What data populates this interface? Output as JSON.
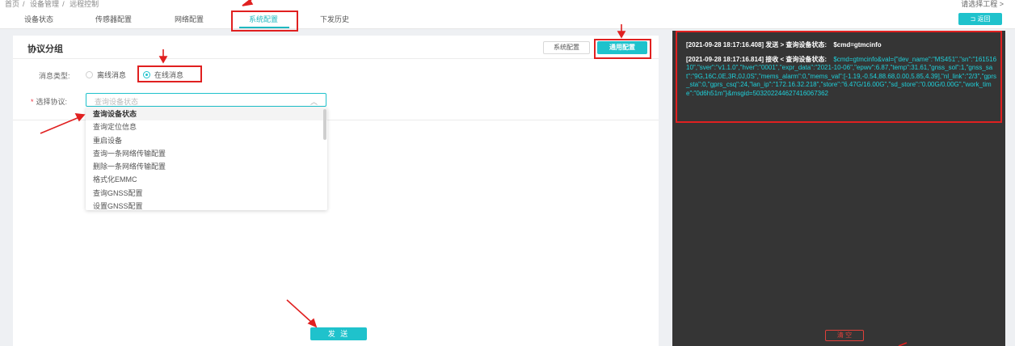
{
  "breadcrumb": {
    "home": "首页",
    "sep": "/",
    "device_mgmt": "设备管理",
    "remote": "远程控制"
  },
  "project_select": "请选择工程 >",
  "tabs": [
    {
      "label": "设备状态"
    },
    {
      "label": "传感器配置"
    },
    {
      "label": "网络配置"
    },
    {
      "label": "系统配置",
      "active": true
    },
    {
      "label": "下发历史"
    }
  ],
  "back_button": "⊐ 返回",
  "panel": {
    "title": "协议分组",
    "system_config_btn": "系统配置",
    "common_config_btn": "通用配置",
    "message_type_label": "消息类型:",
    "radio_offline": "离线消息",
    "radio_online": "在线消息",
    "protocol_label": "选择协议:",
    "protocol_required": "*",
    "protocol_placeholder": "查询设备状态",
    "chevron": "︿",
    "send_button": "发 送"
  },
  "dropdown_options": [
    "查询设备状态",
    "查询定位信息",
    "重启设备",
    "查询一条网络传输配置",
    "删除一条网络传输配置",
    "格式化EMMC",
    "查询GNSS配置",
    "设置GNSS配置"
  ],
  "log": {
    "entries": [
      {
        "head": "[2021-09-28 18:17:16.408] 发送 > 查询设备状态:",
        "body": "$cmd=gtmcinfo",
        "body_white": true
      },
      {
        "head": "[2021-09-28 18:17:16.814] 接收 < 查询设备状态:",
        "body": "$cmd=gtmcinfo&val={\"dev_name\":\"MS451\",\"sn\":\"16151610\",\"sver\":\"v1.1.0\",\"hver\":\"0001\",\"expr_data\":\"2021-10-06\",\"epwv\":6.87,\"temp\":31.61,\"gnss_sol\":1,\"gnss_sat\":\"9G,16C,0E,3R,0J,0S\",\"mems_alarm\":0,\"mems_val\":[-1.19,-0.54,88.68,0.00,5.85,4.39],\"nl_link\":\"2/3\",\"gprs_sta\":0,\"gprs_csq\":24,\"lan_ip\":\"172.16.32.218\",\"store\":\"6.47G/16.00G\",\"sd_store\":\"0.00G/0.00G\",\"work_time\":\"0d6h51m\"}&msgid=503202244627416067362",
        "body_white": false
      }
    ],
    "clear_button": "清 空"
  },
  "colors": {
    "accent": "#1fc2cc",
    "annotation_red": "#e02020",
    "log_bg": "#353535"
  }
}
